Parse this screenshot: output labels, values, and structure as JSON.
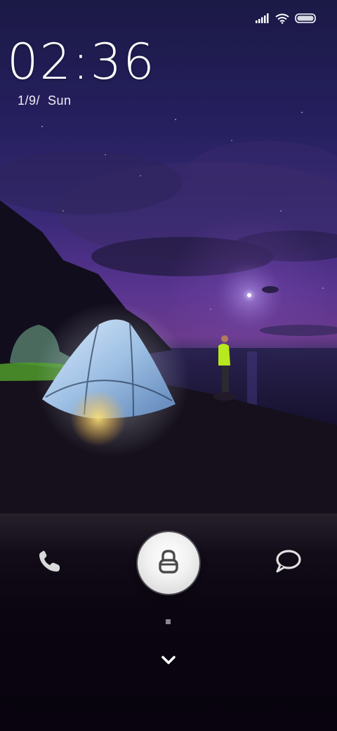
{
  "status_bar": {
    "signal_icon": "signal-bars-icon",
    "wifi_icon": "wifi-icon",
    "battery_icon": "battery-icon"
  },
  "lock_screen": {
    "time": "02:36",
    "date": "1/9/  Sun"
  },
  "dock": {
    "phone_icon": "phone-icon",
    "unlock_icon": "lock-icon",
    "message_icon": "message-bubble-icon",
    "expand_icon": "chevron-down-icon"
  },
  "colors": {
    "sky_top": "#1a1540",
    "sky_mid": "#3b2a78",
    "horizon_glow": "#7a3f86",
    "tent": "#bcd6ee",
    "grass": "#4f9a2a",
    "person_jacket": "#b8e81e",
    "dock_bg": "#0a0510",
    "unlock_button": "#f2f2f2"
  }
}
